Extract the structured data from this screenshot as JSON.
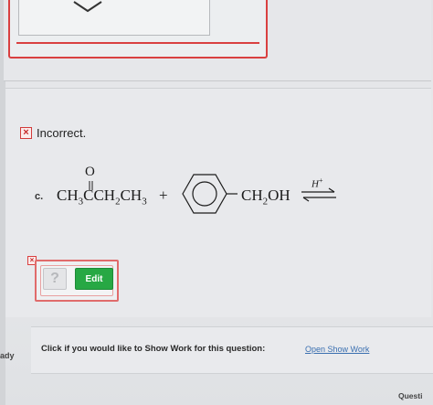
{
  "status": {
    "label": "Incorrect.",
    "icon": "x-icon"
  },
  "question": {
    "part_label": "c.",
    "reactant1": {
      "prefix": "CH",
      "sub1": "3",
      "mid": "CCH",
      "sub2": "2",
      "mid2": "CH",
      "sub3": "3",
      "oxygen": "O"
    },
    "plus": "+",
    "product": {
      "prefix": "CH",
      "sub": "2",
      "suffix": "OH"
    },
    "catalyst": {
      "base": "H",
      "charge": "+"
    }
  },
  "toolbox": {
    "help_label": "?",
    "edit_label": "Edit",
    "error_tag": "×"
  },
  "show_work": {
    "label": "Click if you would like to Show Work for this question:",
    "link": "Open Show Work"
  },
  "edge_text": {
    "left": "ady",
    "bottom_right": "Questi"
  },
  "colors": {
    "error": "#d94040",
    "edit_button": "#27a844",
    "link": "#3a6fb0"
  }
}
